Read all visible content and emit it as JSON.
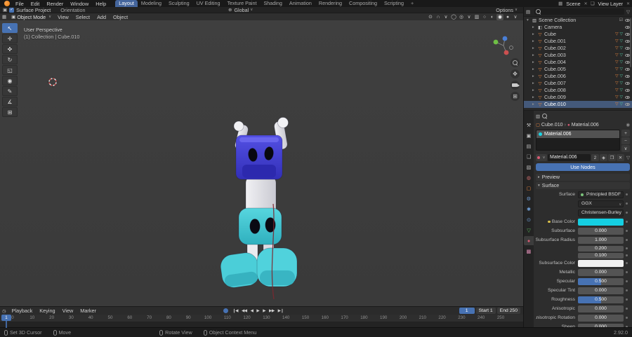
{
  "colors": {
    "accent": "#4772b3",
    "material_cyan": "#1bd5e5",
    "object_orange": "#e8853e",
    "selected_row": "#44597a"
  },
  "topbar": {
    "menus": [
      "File",
      "Edit",
      "Render",
      "Window",
      "Help"
    ],
    "tabs": [
      "Layout",
      "Modeling",
      "Sculpting",
      "UV Editing",
      "Texture Paint",
      "Shading",
      "Animation",
      "Rendering",
      "Compositing",
      "Scripting"
    ],
    "active_tab": "Layout",
    "new_tab_button": "+",
    "scene": {
      "label": "Scene"
    },
    "view_layer": {
      "label": "View Layer"
    }
  },
  "tool_settings": {
    "surface_project_label": "Surface Project",
    "surface_project_checked": "✓",
    "orientation_label": "Orientation",
    "transform_orientation": "Global",
    "options_label": "Options"
  },
  "viewport": {
    "header": {
      "mode": "Object Mode",
      "menus": [
        "View",
        "Select",
        "Add",
        "Object"
      ]
    },
    "overlay": {
      "line1": "User Perspective",
      "line2": "(1) Collection | Cube.010"
    },
    "tools": [
      {
        "name": "tool-select-box",
        "glyph": "↖",
        "active": true
      },
      {
        "name": "tool-cursor",
        "glyph": "✛"
      },
      {
        "name": "tool-move",
        "glyph": "✜"
      },
      {
        "name": "tool-rotate",
        "glyph": "↻"
      },
      {
        "name": "tool-scale",
        "glyph": "◱"
      },
      {
        "name": "tool-transform",
        "glyph": "◉"
      },
      {
        "name": "tool-annotate",
        "glyph": "✎"
      },
      {
        "name": "tool-measure",
        "glyph": "∡"
      },
      {
        "name": "tool-add-cube",
        "glyph": "⊞"
      }
    ],
    "side_icons": [
      {
        "name": "zoom-icon",
        "type": "mag"
      },
      {
        "name": "pan-icon",
        "glyph": "✥"
      },
      {
        "name": "camera-view-icon",
        "type": "cam"
      },
      {
        "name": "toggle-ortho-icon",
        "glyph": "⊞"
      }
    ],
    "header_icons": [
      {
        "name": "pivot-point-icon",
        "glyph": "⊙"
      },
      {
        "name": "snap-magnet-icon",
        "glyph": "∩"
      },
      {
        "name": "snap-dropdown-icon",
        "glyph": "∨"
      },
      {
        "name": "proportional-edit-icon",
        "glyph": "◯"
      },
      {
        "name": "overlays-icon",
        "glyph": "◎"
      },
      {
        "name": "overlays-dropdown-icon",
        "glyph": "∨"
      },
      {
        "name": "xray-toggle-icon",
        "glyph": "▥"
      },
      {
        "name": "shading-wireframe-icon",
        "glyph": "○"
      },
      {
        "name": "shading-solid-icon",
        "glyph": "◐"
      },
      {
        "name": "shading-material-icon",
        "glyph": "◉",
        "active": true
      },
      {
        "name": "shading-rendered-icon",
        "glyph": "●"
      },
      {
        "name": "shading-dropdown-icon",
        "glyph": "∨"
      }
    ]
  },
  "outliner": {
    "root": {
      "name": "Scene Collection",
      "type": "collection"
    },
    "items": [
      {
        "name": "Camera",
        "type": "camera"
      },
      {
        "name": "Cube",
        "type": "mesh"
      },
      {
        "name": "Cube.001",
        "type": "mesh"
      },
      {
        "name": "Cube.002",
        "type": "mesh"
      },
      {
        "name": "Cube.003",
        "type": "mesh"
      },
      {
        "name": "Cube.004",
        "type": "mesh"
      },
      {
        "name": "Cube.005",
        "type": "mesh"
      },
      {
        "name": "Cube.006",
        "type": "mesh"
      },
      {
        "name": "Cube.007",
        "type": "mesh"
      },
      {
        "name": "Cube.008",
        "type": "mesh"
      },
      {
        "name": "Cube.009",
        "type": "mesh"
      },
      {
        "name": "Cube.010",
        "type": "mesh",
        "selected": true
      }
    ]
  },
  "properties": {
    "tabs": [
      {
        "name": "tool",
        "glyph": "⚒",
        "color": "#b8b8b8"
      },
      {
        "name": "render",
        "glyph": "▣",
        "color": "#b8b8b8"
      },
      {
        "name": "output",
        "glyph": "▤",
        "color": "#b8b8b8"
      },
      {
        "name": "view-layer",
        "glyph": "❏",
        "color": "#b8b8b8"
      },
      {
        "name": "scene",
        "glyph": "▧",
        "color": "#b8b8b8"
      },
      {
        "name": "world",
        "glyph": "◍",
        "color": "#c46a6a"
      },
      {
        "name": "object",
        "glyph": "▢",
        "color": "#e8853e"
      },
      {
        "name": "modifiers",
        "glyph": "⚙",
        "color": "#6f9fd8"
      },
      {
        "name": "particles",
        "glyph": "✱",
        "color": "#6f9fd8"
      },
      {
        "name": "physics",
        "glyph": "⊙",
        "color": "#6f9fd8"
      },
      {
        "name": "object-data",
        "glyph": "▽",
        "color": "#5fbf5f"
      },
      {
        "name": "material",
        "glyph": "●",
        "color": "#d85c74",
        "active": true
      },
      {
        "name": "texture",
        "glyph": "▩",
        "color": "#d88ab0"
      }
    ],
    "breadcrumb": {
      "object": "Cube.010",
      "separator": "›",
      "material": "Material.006"
    },
    "slots": [
      {
        "name": "Material.006",
        "color": "#1bd5e5",
        "selected": true
      }
    ],
    "slot_buttons": {
      "add": "+",
      "remove": "−",
      "specials": "∨"
    },
    "datablock": {
      "name": "Material.006",
      "users": "2"
    },
    "use_nodes_label": "Use Nodes",
    "panels": {
      "preview": "Preview",
      "surface": "Surface"
    },
    "fields": [
      {
        "label": "Surface",
        "type": "shader",
        "value": "Principled BSDF"
      },
      {
        "label": "",
        "type": "menu",
        "value": "GGX"
      },
      {
        "label": "",
        "type": "menu",
        "value": "Christensen-Burley"
      },
      {
        "label": "Base Color",
        "type": "color",
        "color": "#15cfe2",
        "dot": "#d8c04a"
      },
      {
        "label": "Subsurface",
        "type": "slider",
        "value": "0.000",
        "fill": 0
      },
      {
        "label": "Subsurface Radius",
        "type": "number",
        "value": "1.000",
        "dot": "#5a87c9"
      },
      {
        "label": "",
        "type": "number",
        "value": "0.200",
        "compact": true
      },
      {
        "label": "",
        "type": "number",
        "value": "0.100",
        "compact": true
      },
      {
        "label": "Subsurface Color",
        "type": "color",
        "color": "#f0f0f0"
      },
      {
        "label": "Metallic",
        "type": "slider",
        "value": "0.000",
        "fill": 0
      },
      {
        "label": "Specular",
        "type": "slider",
        "value": "0.500",
        "fill": 0.5
      },
      {
        "label": "Specular Tint",
        "type": "slider",
        "value": "0.000",
        "fill": 0
      },
      {
        "label": "Roughness",
        "type": "slider",
        "value": "0.500",
        "fill": 0.5
      },
      {
        "label": "Anisotropic",
        "type": "slider",
        "value": "0.000",
        "fill": 0
      },
      {
        "label": "Anisotropic Rotation",
        "type": "slider",
        "value": "0.000",
        "fill": 0
      },
      {
        "label": "Sheen",
        "type": "slider",
        "value": "0.000",
        "fill": 0
      }
    ]
  },
  "timeline": {
    "menus": [
      "Playback",
      "Keying",
      "View",
      "Marker"
    ],
    "transport": [
      {
        "name": "jump-to-start",
        "glyph": "❙◀"
      },
      {
        "name": "jump-prev-keyframe",
        "glyph": "◀◀"
      },
      {
        "name": "prev-frame",
        "glyph": "◀"
      },
      {
        "name": "play",
        "glyph": "▶"
      },
      {
        "name": "next-frame",
        "glyph": "▶"
      },
      {
        "name": "jump-next-keyframe",
        "glyph": "▶▶"
      },
      {
        "name": "jump-to-end",
        "glyph": "▶❙"
      }
    ],
    "current_frame": "1",
    "start": "Start 1",
    "end": "End 250",
    "playhead": "1",
    "ticks": [
      0,
      10,
      20,
      30,
      40,
      50,
      60,
      70,
      80,
      90,
      100,
      110,
      120,
      130,
      140,
      150,
      160,
      170,
      180,
      190,
      200,
      210,
      220,
      230,
      240,
      250
    ]
  },
  "statusbar": {
    "hints": [
      "Set 3D Cursor",
      "Move",
      "Rotate View",
      "Object Context Menu"
    ],
    "version": "2.92.0"
  }
}
